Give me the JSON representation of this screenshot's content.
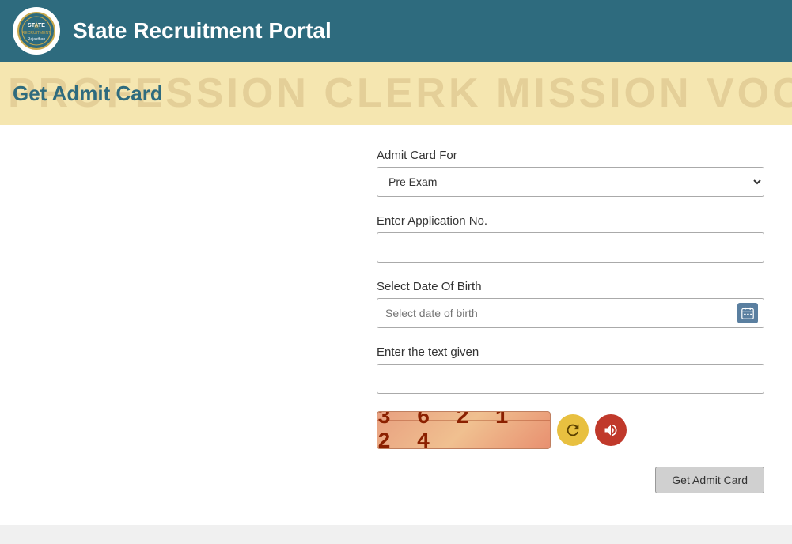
{
  "header": {
    "title": "State Recruitment Portal",
    "logo_alt": "State Recruitment Portal Logo"
  },
  "banner": {
    "title": "Get Admit Card",
    "bg_text": "PROFESSION  CLERK  MISSION  VOCATION  PROFESSION  MONEY"
  },
  "form": {
    "admit_card_for_label": "Admit Card For",
    "admit_card_options": [
      {
        "value": "pre_exam",
        "label": "Pre Exam"
      }
    ],
    "admit_card_selected": "Pre Exam",
    "application_no_label": "Enter Application No.",
    "application_no_placeholder": "",
    "dob_label": "Select Date Of Birth",
    "dob_placeholder": "Select date of birth",
    "captcha_label": "Enter the text given",
    "captcha_placeholder": "",
    "captcha_text": "3 6  2 1  2 4",
    "submit_label": "Get Admit Card"
  }
}
